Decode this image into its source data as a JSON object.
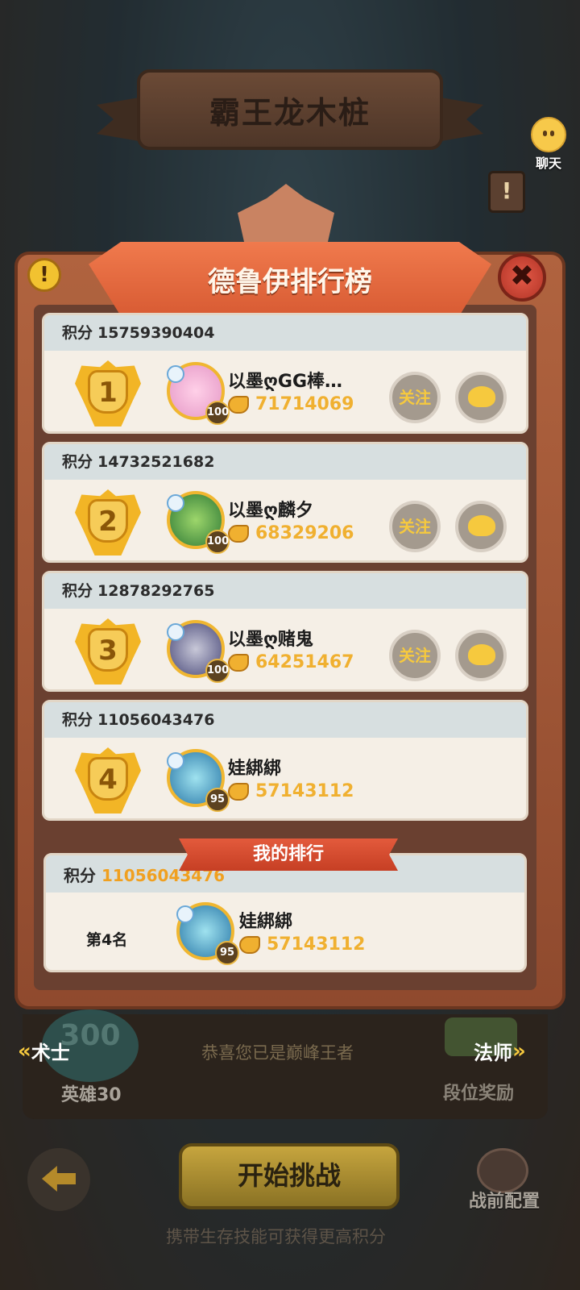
{
  "header": {
    "title": "霸王龙木桩"
  },
  "chat": {
    "label": "聊天"
  },
  "side_marker": {
    "text": "!"
  },
  "leaderboard": {
    "title": "德鲁伊排行榜",
    "info_icon": "!",
    "close_icon": "✖",
    "score_label": "积分",
    "follow_label": "关注",
    "entries": [
      {
        "rank": "1",
        "score": "15759390404",
        "name": "以墨ღGG棒…",
        "level": "100",
        "power": "71714069",
        "show_actions": true
      },
      {
        "rank": "2",
        "score": "14732521682",
        "name": "以墨ღ麟夕",
        "level": "100",
        "power": "68329206",
        "show_actions": true
      },
      {
        "rank": "3",
        "score": "12878292765",
        "name": "以墨ღ赌鬼",
        "level": "100",
        "power": "64251467",
        "show_actions": true
      },
      {
        "rank": "4",
        "score": "11056043476",
        "name": "娃綁綁",
        "level": "95",
        "power": "57143112",
        "show_actions": false
      }
    ]
  },
  "my_rank": {
    "banner": "我的排行",
    "score_label": "积分",
    "score": "11056043476",
    "rank_text": "第4名",
    "name": "娃綁綁",
    "level": "95",
    "power": "57143112"
  },
  "bottom": {
    "hero_badge": "300",
    "left_nav": "术士",
    "right_nav": "法师",
    "hero_count": "英雄30",
    "congrats": "恭喜您已是巅峰王者",
    "rank_reward": "段位奖励",
    "start": "开始挑战",
    "prep": "战前配置",
    "hint": "携带生存技能可获得更高积分"
  },
  "colors": {
    "accent_gold": "#f0b030",
    "ribbon_red": "#d85b33",
    "card_bg": "#f5efe6"
  }
}
